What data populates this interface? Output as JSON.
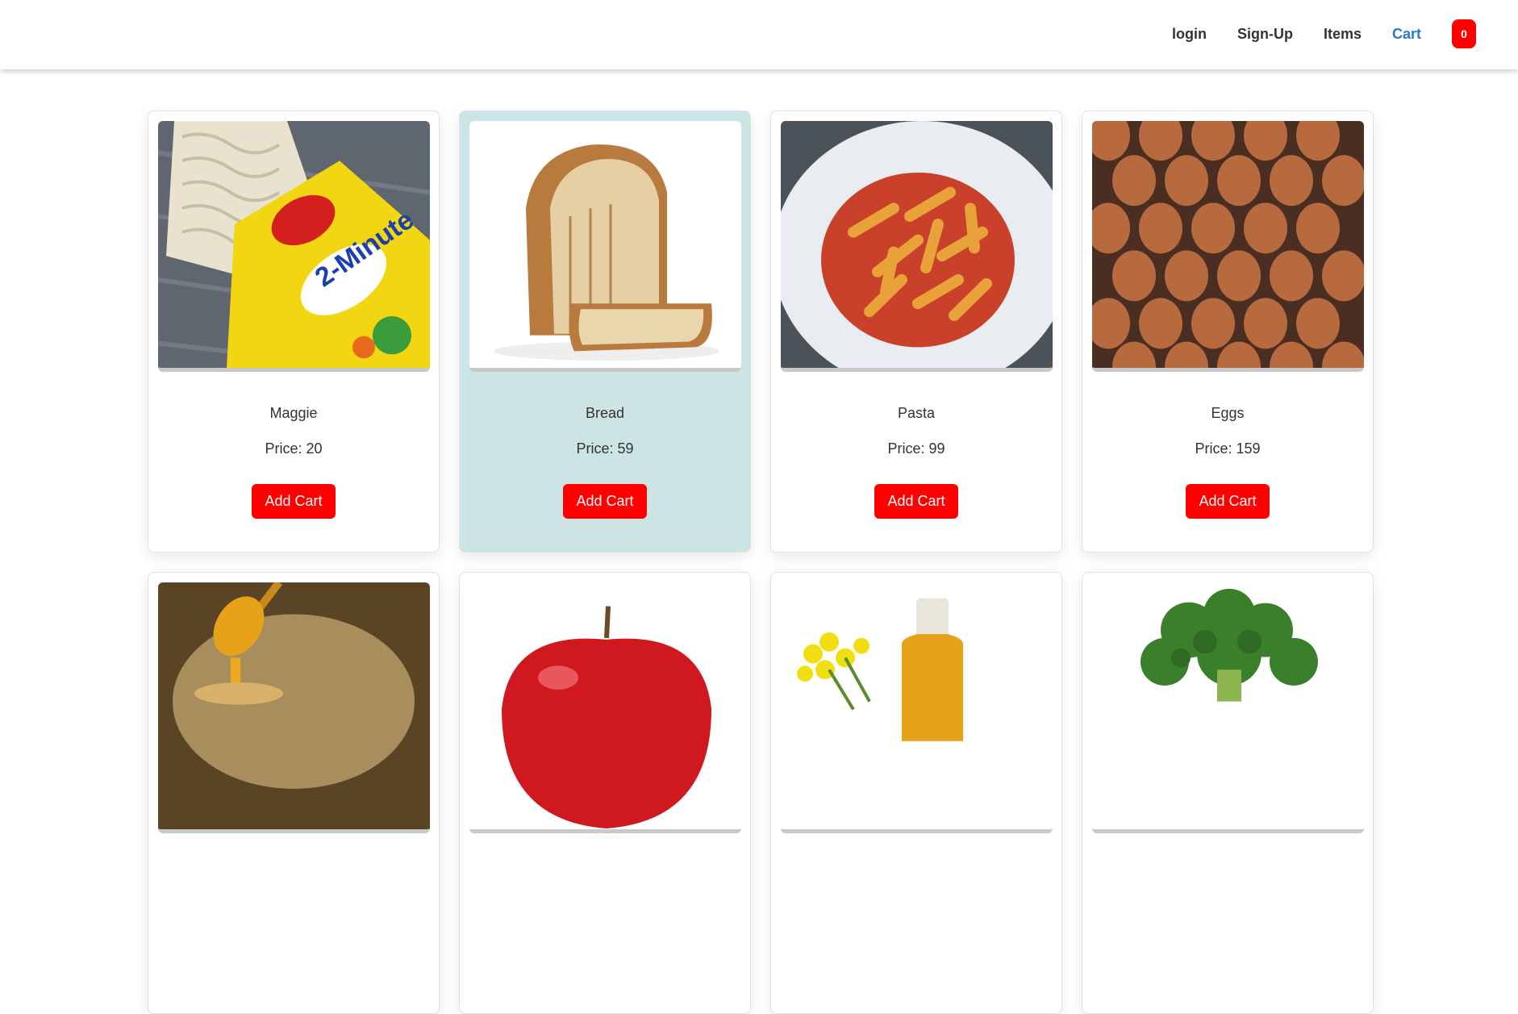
{
  "nav": {
    "links": [
      "login",
      "Sign-Up",
      "Items",
      "Cart"
    ],
    "active": "Cart",
    "cart_count": "0"
  },
  "colors": {
    "accent": "#ff0000",
    "active_link": "#2a78c8",
    "highlight_card": "#cde4e5"
  },
  "products": [
    {
      "name": "Maggie",
      "price": "Price: 20",
      "button": "Add Cart",
      "image": "maggi-noodles-image"
    },
    {
      "name": "Bread",
      "price": "Price: 59",
      "button": "Add Cart",
      "image": "bread-image"
    },
    {
      "name": "Pasta",
      "price": "Price: 99",
      "button": "Add Cart",
      "image": "pasta-image"
    },
    {
      "name": "Eggs",
      "price": "Price: 159",
      "button": "Add Cart",
      "image": "eggs-image"
    },
    {
      "name": "",
      "price": "",
      "button": "",
      "image": "honey-image"
    },
    {
      "name": "",
      "price": "",
      "button": "",
      "image": "apple-image"
    },
    {
      "name": "",
      "price": "",
      "button": "",
      "image": "oil-image"
    },
    {
      "name": "",
      "price": "",
      "button": "",
      "image": "broccoli-image"
    }
  ]
}
